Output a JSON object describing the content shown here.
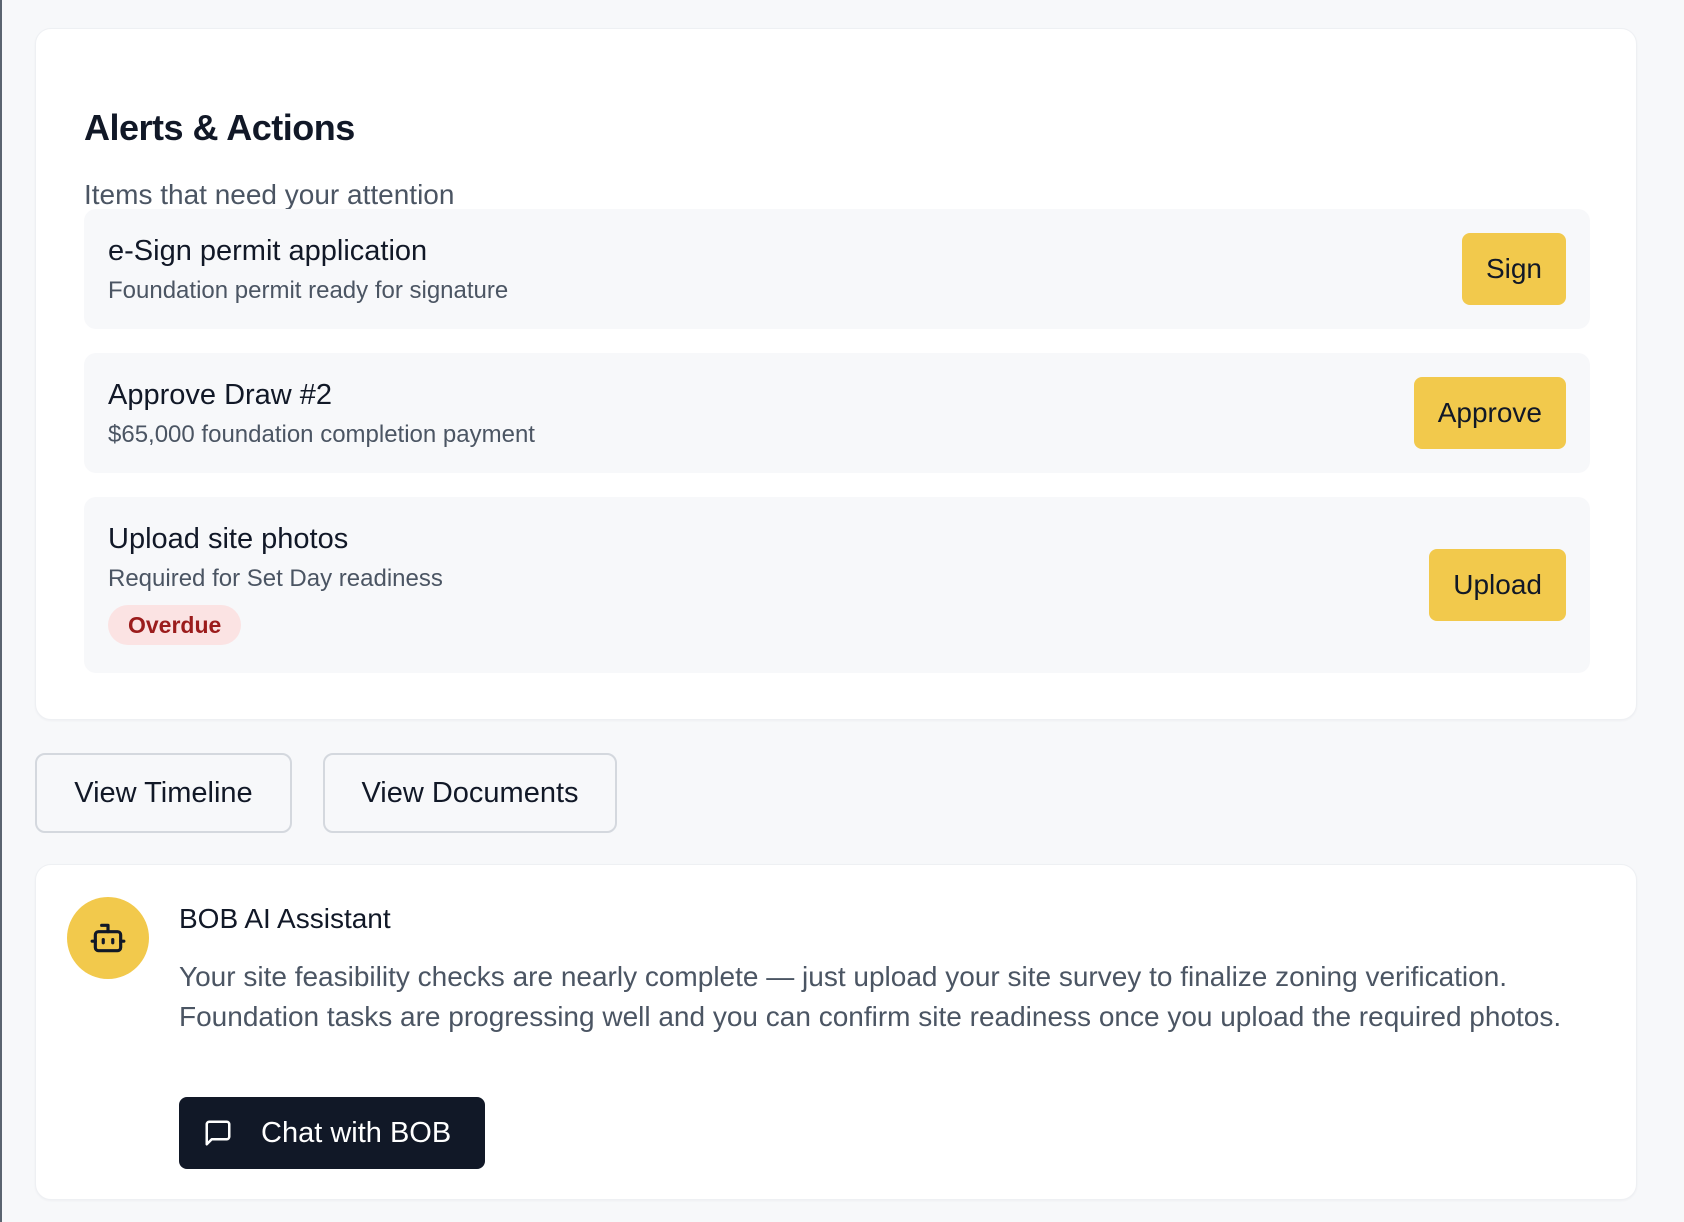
{
  "alerts": {
    "title": "Alerts & Actions",
    "subtitle": "Items that need your attention",
    "items": [
      {
        "title": "e-Sign permit application",
        "description": "Foundation permit ready for signature",
        "action_label": "Sign"
      },
      {
        "title": "Approve Draw #2",
        "description": "$65,000 foundation completion payment",
        "action_label": "Approve"
      },
      {
        "title": "Upload site photos",
        "description": "Required for Set Day readiness",
        "badge": "Overdue",
        "action_label": "Upload"
      }
    ]
  },
  "quick_actions": {
    "view_timeline_label": "View Timeline",
    "view_documents_label": "View Documents"
  },
  "assistant": {
    "avatar_icon": "robot-icon",
    "title": "BOB AI Assistant",
    "message": "Your site feasibility checks are nearly complete — just upload your site survey to finalize zoning verification. Foundation tasks are progressing well and you can confirm site readiness once you upload the required photos.",
    "chat_button_icon": "message-square-icon",
    "chat_button_label": "Chat with BOB"
  },
  "colors": {
    "accent_yellow": "#f2c94c",
    "dark_button": "#111827",
    "overdue_text": "#9b1c1c",
    "overdue_bg": "#fbe3e3",
    "page_bg": "#f7f8fa"
  }
}
